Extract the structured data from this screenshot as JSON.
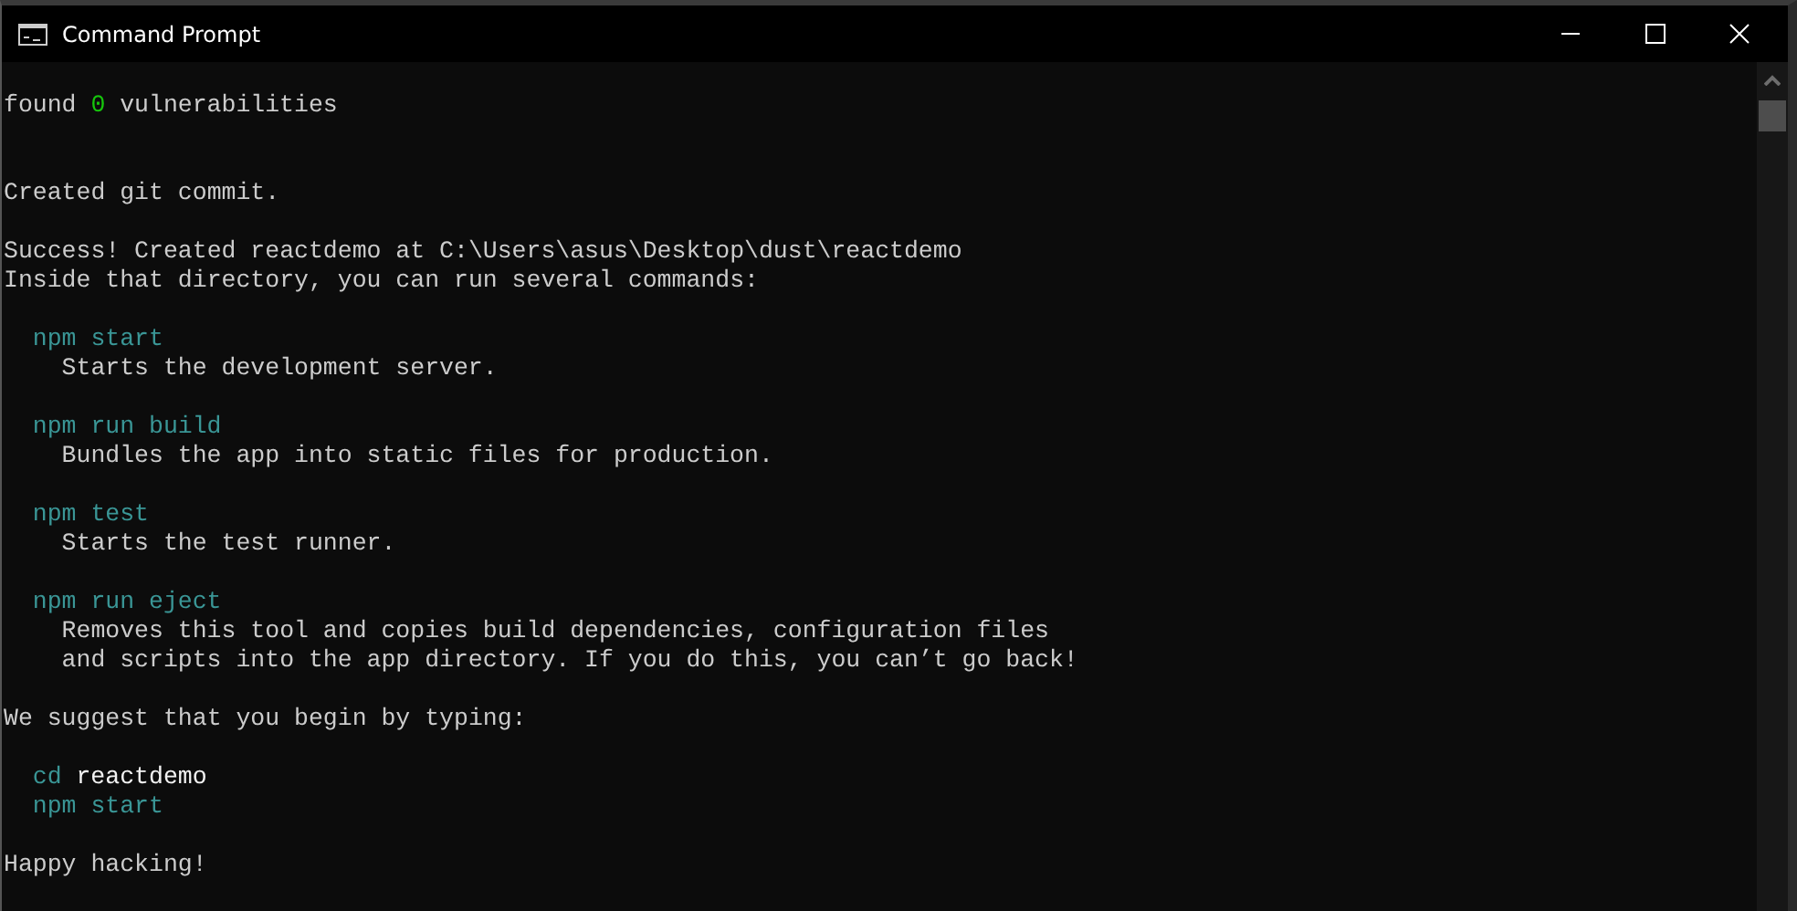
{
  "window": {
    "title": "Command Prompt"
  },
  "lines": [
    {
      "kind": "text",
      "segments": [
        {
          "text": "found",
          "color": "#cccccc"
        },
        {
          "text": "0",
          "color": "#16c60c"
        },
        {
          "text": "vulnerabilities",
          "color": "#cccccc"
        }
      ]
    },
    {
      "kind": "blank"
    },
    {
      "kind": "blank"
    },
    {
      "kind": "text",
      "segments": [
        {
          "text": "Created git commit.",
          "color": "#cccccc"
        }
      ]
    },
    {
      "kind": "blank"
    },
    {
      "kind": "text",
      "segments": [
        {
          "text": "Success! Created reactdemo at C:\\Users\\asus\\Desktop\\dust\\reactdemo",
          "color": "#cccccc"
        }
      ]
    },
    {
      "kind": "text",
      "segments": [
        {
          "text": "Inside that directory, you can run several commands:",
          "color": "#cccccc"
        }
      ]
    },
    {
      "kind": "blank"
    },
    {
      "kind": "command",
      "segments": [
        {
          "text": "npm start",
          "color": "#3a9696"
        }
      ]
    },
    {
      "kind": "detail",
      "segments": [
        {
          "text": "Starts the development server.",
          "color": "#cccccc"
        }
      ]
    },
    {
      "kind": "blank"
    },
    {
      "kind": "command",
      "segments": [
        {
          "text": "npm run build",
          "color": "#3a9696"
        }
      ]
    },
    {
      "kind": "detail",
      "segments": [
        {
          "text": "Bundles the app into static files for production.",
          "color": "#cccccc"
        }
      ]
    },
    {
      "kind": "blank"
    },
    {
      "kind": "command",
      "segments": [
        {
          "text": "npm test",
          "color": "#3a9696"
        }
      ]
    },
    {
      "kind": "detail",
      "segments": [
        {
          "text": "Starts the test runner.",
          "color": "#cccccc"
        }
      ]
    },
    {
      "kind": "blank"
    },
    {
      "kind": "command",
      "segments": [
        {
          "text": "npm run eject",
          "color": "#3a9696"
        }
      ]
    },
    {
      "kind": "detail",
      "segments": [
        {
          "text": "Removes this tool and copies build dependencies, configuration files",
          "color": "#cccccc"
        }
      ]
    },
    {
      "kind": "detail",
      "segments": [
        {
          "text": "and scripts into the app directory. If you do this, you can’t go back!",
          "color": "#cccccc"
        }
      ]
    },
    {
      "kind": "blank"
    },
    {
      "kind": "text",
      "segments": [
        {
          "text": "We suggest that you begin by typing:",
          "color": "#cccccc"
        }
      ]
    },
    {
      "kind": "blank"
    },
    {
      "kind": "command",
      "segments": [
        {
          "text": "cd",
          "color": "#3a9696"
        },
        {
          "text": "reactdemo",
          "color": "#f2f2f2"
        }
      ]
    },
    {
      "kind": "command",
      "segments": [
        {
          "text": "npm start",
          "color": "#3a9696"
        }
      ]
    },
    {
      "kind": "blank"
    },
    {
      "kind": "text",
      "segments": [
        {
          "text": "Happy hacking!",
          "color": "#cccccc"
        }
      ]
    }
  ]
}
